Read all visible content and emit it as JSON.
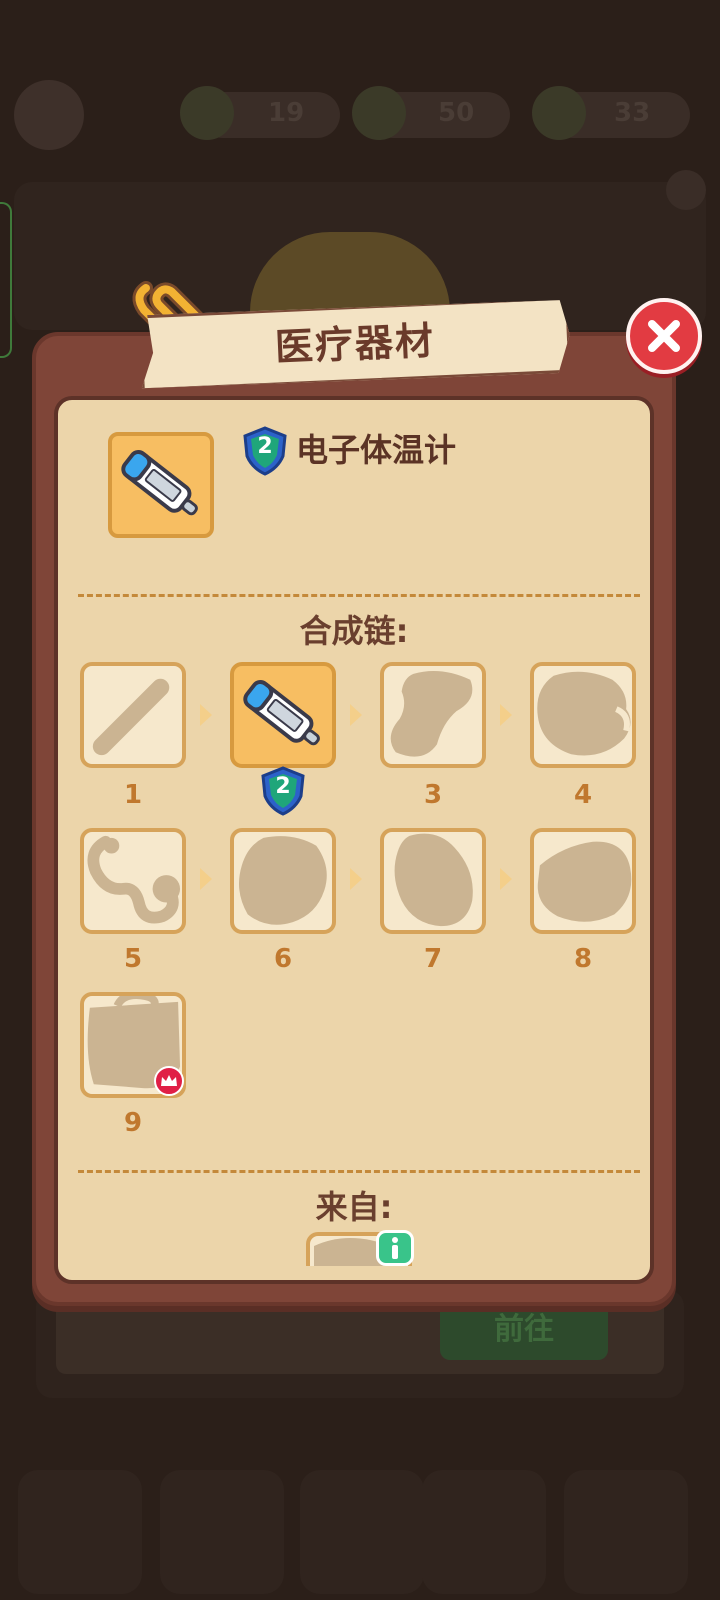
{
  "background": {
    "stats": [
      {
        "icon": "energy-icon",
        "value": "19"
      },
      {
        "icon": "cash-icon",
        "value": "50"
      },
      {
        "icon": "gem-icon",
        "value": "33"
      }
    ],
    "go_button_label": "前往"
  },
  "dialog": {
    "title": "医疗器材",
    "item": {
      "name": "电子体温计",
      "level": "2",
      "icon": "digital-thermometer-icon"
    },
    "chain": {
      "title": "合成链:",
      "items": [
        {
          "num": "1",
          "icon": "thermometer-silhouette-icon",
          "unlocked": false
        },
        {
          "num": "2",
          "icon": "digital-thermometer-icon",
          "unlocked": true,
          "current": true
        },
        {
          "num": "3",
          "icon": "locked-item-silhouette-icon",
          "unlocked": false
        },
        {
          "num": "4",
          "icon": "locked-item-silhouette-icon",
          "unlocked": false
        },
        {
          "num": "5",
          "icon": "stethoscope-silhouette-icon",
          "unlocked": false
        },
        {
          "num": "6",
          "icon": "locked-item-silhouette-icon",
          "unlocked": false
        },
        {
          "num": "7",
          "icon": "locked-item-silhouette-icon",
          "unlocked": false
        },
        {
          "num": "8",
          "icon": "locked-item-silhouette-icon",
          "unlocked": false
        },
        {
          "num": "9",
          "icon": "medical-bag-silhouette-icon",
          "unlocked": false,
          "max": true
        }
      ]
    },
    "source": {
      "title": "来自:",
      "icon": "source-generator-silhouette-icon"
    }
  },
  "colors": {
    "dialog_frame": "#7f4538",
    "panel": "#ecd5aa",
    "slot_current": "#f7be62",
    "level_shield": "#2c62c9",
    "close_button": "#e23b42",
    "silhouette": "#cbb492",
    "info_badge": "#39c48a"
  }
}
